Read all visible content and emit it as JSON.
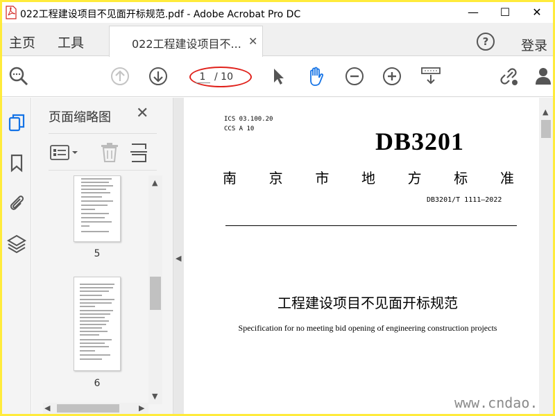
{
  "window": {
    "title": "022工程建设项目不见面开标规范.pdf - Adobe Acrobat Pro DC",
    "minimize": "—",
    "maximize": "☐",
    "close": "✕"
  },
  "tabs": {
    "home": "主页",
    "tools": "工具",
    "document": "022工程建设项目不...",
    "document_close": "✕",
    "help": "?",
    "login": "登录"
  },
  "toolbar": {
    "page_current": "1",
    "page_total": "/ 10"
  },
  "thumbnail_panel": {
    "title": "页面缩略图",
    "close": "✕",
    "pages": [
      {
        "label": "5"
      },
      {
        "label": "6"
      }
    ]
  },
  "document": {
    "ics": "ICS  03.100.20",
    "ccs": "CCS  A 10",
    "standard_code": "DB3201",
    "org_chars": [
      "南",
      "京",
      "市",
      "地",
      "方",
      "标",
      "准"
    ],
    "standard_number": "DB3201/T 1111—2022",
    "title_cn": "工程建设项目不见面开标规范",
    "title_en": "Specification for no meeting bid opening of engineering construction projects"
  },
  "watermark": "www.cndao.com",
  "colors": {
    "frame_border": "#ffeb3b",
    "annotation_oval": "#e0201a",
    "accent_blue": "#1473e6"
  }
}
